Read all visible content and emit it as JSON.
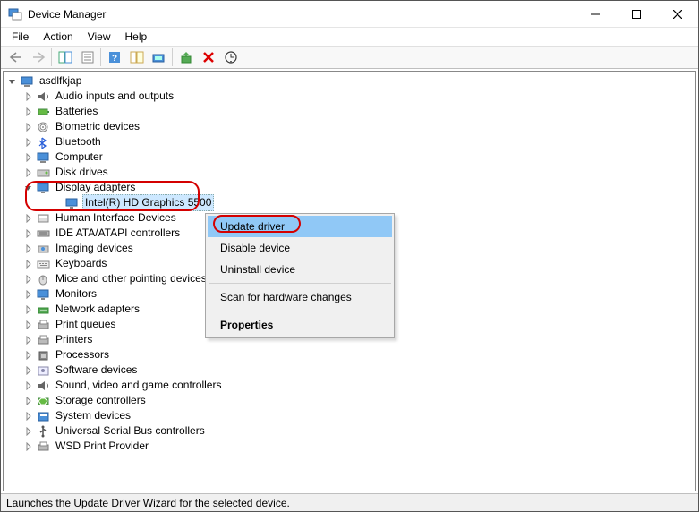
{
  "titlebar": {
    "title": "Device Manager"
  },
  "menubar": {
    "items": [
      "File",
      "Action",
      "View",
      "Help"
    ]
  },
  "toolbar": {
    "icons": [
      "back-icon",
      "forward-icon",
      "show-hide-console-icon",
      "properties-icon",
      "help-icon",
      "help-topics-icon",
      "scan-icon",
      "update-driver-icon",
      "uninstall-icon",
      "scan-hardware-icon"
    ]
  },
  "tree": {
    "root": {
      "label": "asdlfkjap",
      "expanded": true
    },
    "items": [
      {
        "label": "Audio inputs and outputs",
        "icon": "audio-icon"
      },
      {
        "label": "Batteries",
        "icon": "battery-icon"
      },
      {
        "label": "Biometric devices",
        "icon": "biometric-icon"
      },
      {
        "label": "Bluetooth",
        "icon": "bluetooth-icon"
      },
      {
        "label": "Computer",
        "icon": "computer-icon"
      },
      {
        "label": "Disk drives",
        "icon": "disk-icon"
      },
      {
        "label": "Display adapters",
        "icon": "display-icon",
        "expanded": true,
        "children": [
          {
            "label": "Intel(R) HD Graphics 5500",
            "icon": "display-icon",
            "selected": true
          }
        ]
      },
      {
        "label": "Human Interface Devices",
        "icon": "hid-icon"
      },
      {
        "label": "IDE ATA/ATAPI controllers",
        "icon": "ide-icon"
      },
      {
        "label": "Imaging devices",
        "icon": "imaging-icon"
      },
      {
        "label": "Keyboards",
        "icon": "keyboard-icon"
      },
      {
        "label": "Mice and other pointing devices",
        "icon": "mouse-icon"
      },
      {
        "label": "Monitors",
        "icon": "monitor-icon"
      },
      {
        "label": "Network adapters",
        "icon": "network-icon"
      },
      {
        "label": "Print queues",
        "icon": "printqueue-icon"
      },
      {
        "label": "Printers",
        "icon": "printer-icon"
      },
      {
        "label": "Processors",
        "icon": "processor-icon"
      },
      {
        "label": "Software devices",
        "icon": "software-icon"
      },
      {
        "label": "Sound, video and game controllers",
        "icon": "sound-icon"
      },
      {
        "label": "Storage controllers",
        "icon": "storage-icon"
      },
      {
        "label": "System devices",
        "icon": "system-icon"
      },
      {
        "label": "Universal Serial Bus controllers",
        "icon": "usb-icon"
      },
      {
        "label": "WSD Print Provider",
        "icon": "wsd-icon"
      }
    ]
  },
  "contextmenu": {
    "items": [
      {
        "label": "Update driver",
        "hover": true
      },
      {
        "label": "Disable device"
      },
      {
        "label": "Uninstall device"
      },
      {
        "sep": true
      },
      {
        "label": "Scan for hardware changes"
      },
      {
        "sep": true
      },
      {
        "label": "Properties",
        "bold": true
      }
    ]
  },
  "statusbar": {
    "text": "Launches the Update Driver Wizard for the selected device."
  }
}
